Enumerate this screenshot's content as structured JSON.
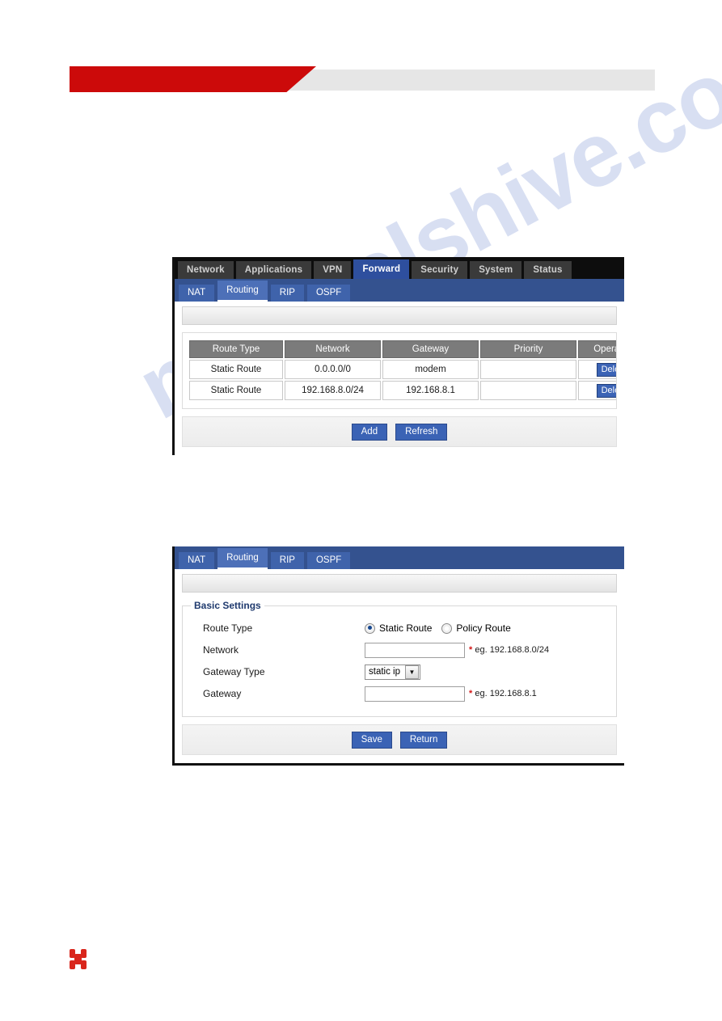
{
  "document": {
    "watermark_text": "manualshive.com",
    "header_accent_color": "#cc0a0a",
    "header_bar_color": "#e6e6e6",
    "logo_color": "#d9261c"
  },
  "panel_list": {
    "topnav": {
      "items": [
        {
          "label": "Network",
          "active": false
        },
        {
          "label": "Applications",
          "active": false
        },
        {
          "label": "VPN",
          "active": false
        },
        {
          "label": "Forward",
          "active": true
        },
        {
          "label": "Security",
          "active": false
        },
        {
          "label": "System",
          "active": false
        },
        {
          "label": "Status",
          "active": false
        }
      ]
    },
    "subtabs": {
      "items": [
        {
          "label": "NAT",
          "active": false
        },
        {
          "label": "Routing",
          "active": true
        },
        {
          "label": "RIP",
          "active": false
        },
        {
          "label": "OSPF",
          "active": false
        }
      ]
    },
    "table": {
      "columns": [
        "Route Type",
        "Network",
        "Gateway",
        "Priority",
        "Operation"
      ],
      "rows": [
        {
          "route_type": "Static Route",
          "network": "0.0.0.0/0",
          "gateway": "modem",
          "priority": "",
          "operation": "Delete"
        },
        {
          "route_type": "Static Route",
          "network": "192.168.8.0/24",
          "gateway": "192.168.8.1",
          "priority": "",
          "operation": "Delete"
        }
      ]
    },
    "actions": {
      "add_label": "Add",
      "refresh_label": "Refresh"
    }
  },
  "panel_form": {
    "subtabs": {
      "items": [
        {
          "label": "NAT",
          "active": false
        },
        {
          "label": "Routing",
          "active": true
        },
        {
          "label": "RIP",
          "active": false
        },
        {
          "label": "OSPF",
          "active": false
        }
      ]
    },
    "legend": "Basic Settings",
    "fields": {
      "route_type_label": "Route Type",
      "route_type_options": [
        {
          "label": "Static Route",
          "selected": true
        },
        {
          "label": "Policy Route",
          "selected": false
        }
      ],
      "network_label": "Network",
      "network_value": "",
      "network_hint_star": "*",
      "network_hint": "eg. 192.168.8.0/24",
      "gateway_type_label": "Gateway Type",
      "gateway_type_value": "static ip",
      "gateway_type_arrow": "▼",
      "gateway_label": "Gateway",
      "gateway_value": "",
      "gateway_hint_star": "*",
      "gateway_hint": "eg. 192.168.8.1"
    },
    "actions": {
      "save_label": "Save",
      "return_label": "Return"
    }
  }
}
